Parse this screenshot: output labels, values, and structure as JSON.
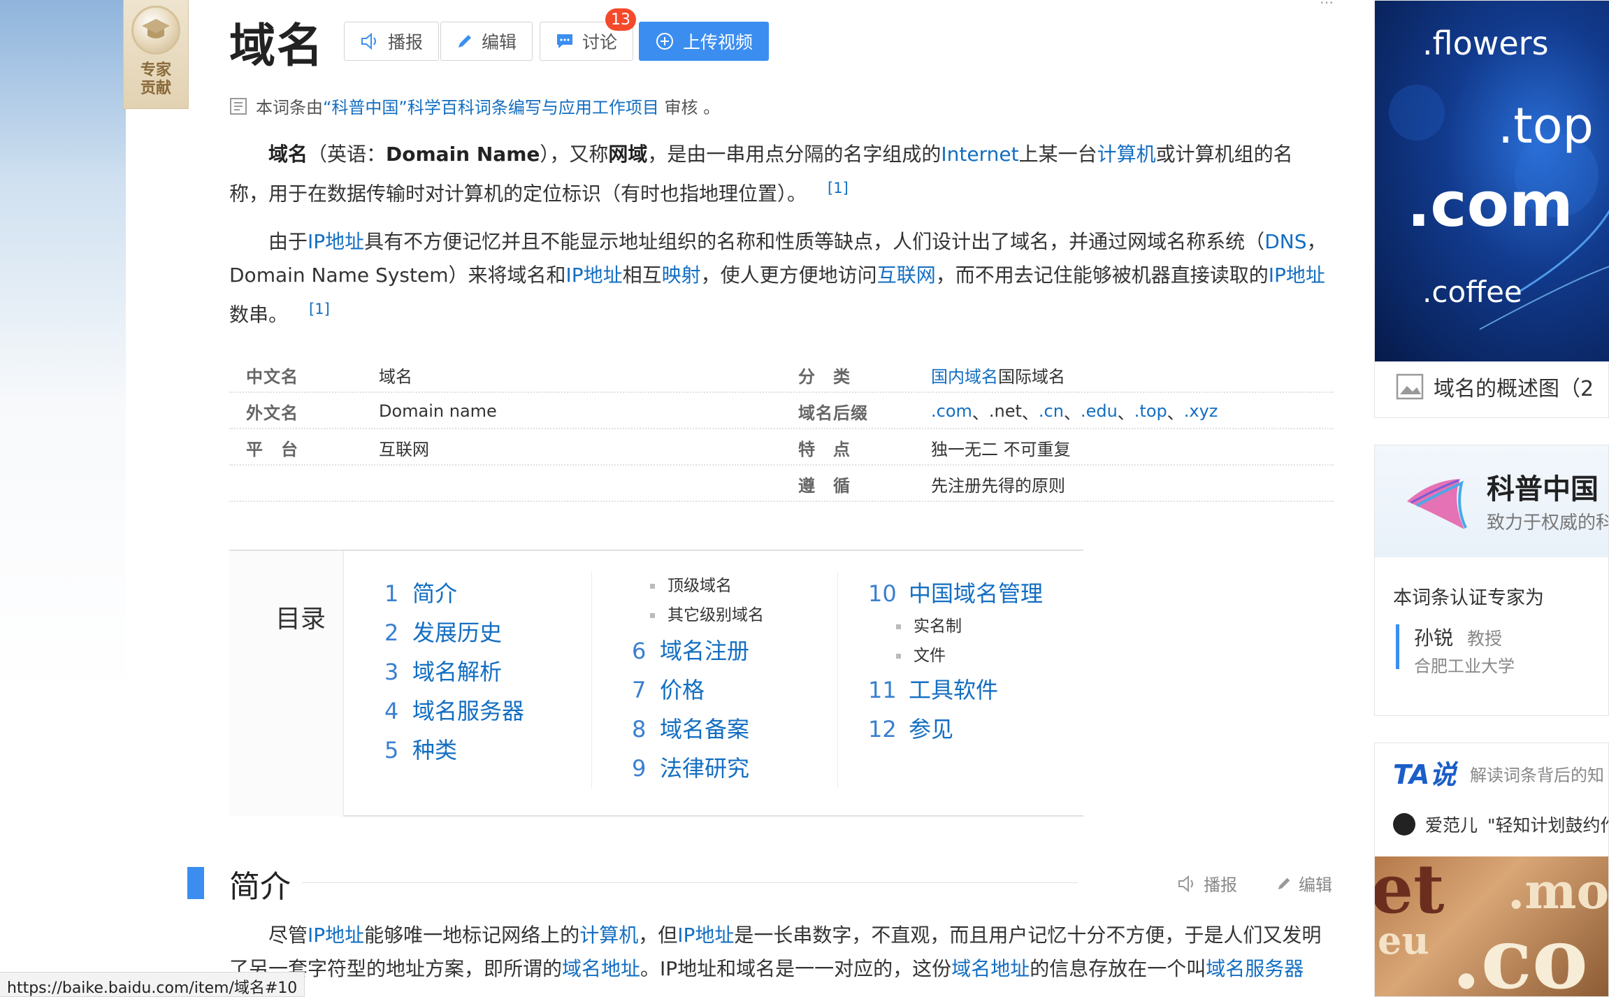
{
  "expert_badge": {
    "label": "专家贡献"
  },
  "top_hint": "…",
  "title": "域名",
  "toolbar": {
    "broadcast": "播报",
    "edit": "编辑",
    "discuss": "讨论",
    "discuss_count": "13",
    "upload": "上传视频"
  },
  "review": {
    "prefix": "本词条由",
    "link": "“科普中国”科学百科词条编写与应用工作项目",
    "suffix": " 审核 。"
  },
  "para1": {
    "t1": "域名",
    "t2": "（英语：",
    "t3": "Domain Name",
    "t4": "），又称",
    "t5": "网域",
    "t6": "，是由一串用点分隔的名字组成的",
    "l1": "Internet",
    "t7": "上某一台",
    "l2": "计算机",
    "t8": "或计算机组的名称，用于在数据传输时对计算机的定位标识（有时也指地理位置）。",
    "ref": "[1]"
  },
  "para2": {
    "t1": "由于",
    "l1": "IP地址",
    "t2": "具有不方便记忆并且不能显示地址组织的名称和性质等缺点，人们设计出了域名，并通过网域名称系统（",
    "l2": "DNS",
    "t3": "，Domain Name System）来将域名和",
    "l3": "IP地址",
    "t4": "相互",
    "l4": "映射",
    "t5": "，使人更方便地访问",
    "l5": "互联网",
    "t6": "，而不用去记住能够被机器直接读取的",
    "l6": "IP地址",
    "t7": "数串。",
    "ref": "[1]"
  },
  "infobox": {
    "left": [
      {
        "name": "中文名",
        "value": "域名"
      },
      {
        "name": "外文名",
        "value": "Domain name"
      },
      {
        "name": "平　台",
        "value": "互联网"
      }
    ],
    "right": [
      {
        "name": "分　类",
        "value_link": "国内域名",
        "value": " 国际域名"
      },
      {
        "name": "域名后缀",
        "suffixes": [
          ".com",
          ".net",
          ".cn",
          ".edu",
          ".top",
          ".xyz"
        ],
        "sep": "、"
      },
      {
        "name": "特　点",
        "value": "独一无二 不可重复"
      },
      {
        "name": "遵　循",
        "value": "先注册先得的原则"
      }
    ]
  },
  "toc": {
    "title": "目录",
    "items": [
      {
        "num": "1",
        "label": "简介"
      },
      {
        "num": "2",
        "label": "发展历史"
      },
      {
        "num": "3",
        "label": "域名解析"
      },
      {
        "num": "4",
        "label": "域名服务器"
      },
      {
        "num": "5",
        "label": "种类"
      },
      {
        "num": "6",
        "label": "域名注册"
      },
      {
        "num": "7",
        "label": "价格"
      },
      {
        "num": "8",
        "label": "域名备案"
      },
      {
        "num": "9",
        "label": "法律研究"
      },
      {
        "num": "10",
        "label": "中国域名管理"
      },
      {
        "num": "11",
        "label": "工具软件"
      },
      {
        "num": "12",
        "label": "参见"
      }
    ],
    "subs_5": [
      "顶级域名",
      "其它级别域名"
    ],
    "subs_10": [
      "实名制",
      "文件"
    ]
  },
  "section": {
    "title": "简介",
    "broadcast": "播报",
    "edit": "编辑"
  },
  "para3": {
    "t1": "尽管",
    "l1": "IP地址",
    "t2": "能够唯一地标记网络上的",
    "l2": "计算机",
    "t3": "，但",
    "l3": "IP地址",
    "t4": "是一长串数字，不直观，而且用户记忆十分不方便，于是人们又发明了另一套字符型的地址方案，即所谓的",
    "l4": "域名地址",
    "t5": "。IP地址和域名是一一对应的，这份",
    "l5": "域名地址",
    "t6": "的信息存放在一个叫",
    "l6": "域名服务器"
  },
  "status_url": "https://baike.baidu.com/item/域名#10",
  "sidebar": {
    "album": {
      "domains": [
        ".flowers",
        ".top",
        ".com",
        ".coffee"
      ],
      "caption": "域名的概述图（2"
    },
    "kepu": {
      "name": "科普中国",
      "slogan": "致力于权威的科",
      "cert": "本词条认证专家为",
      "expert_name": "孙锐",
      "expert_title": "教授",
      "org": "合肥工业大学"
    },
    "tashuo": {
      "logo": "TA说",
      "sub": "解读词条背后的知",
      "user": "爱范儿",
      "user_text": "\"轻知计划鼓约作",
      "img_text": [
        "et",
        "eu",
        ".co",
        ".mo"
      ]
    }
  },
  "colors": {
    "link": "#136ec2",
    "accent": "#3b8ef0",
    "badge": "#f44a2b"
  }
}
